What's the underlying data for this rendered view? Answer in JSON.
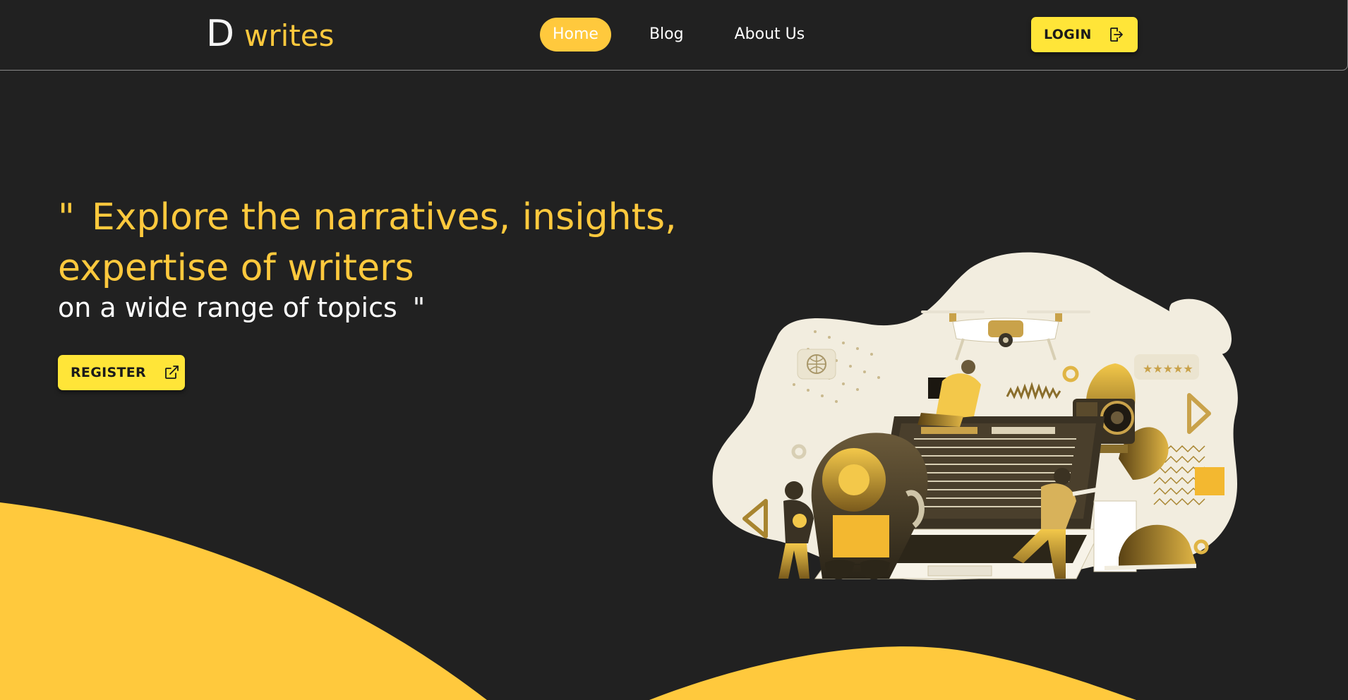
{
  "brand": {
    "letter": "D",
    "word": "writes",
    "accent_color": "#ffc93d",
    "button_color": "#ffe538",
    "background_color": "#212121"
  },
  "nav": {
    "items": [
      {
        "label": "Home",
        "active": true
      },
      {
        "label": "Blog",
        "active": false
      },
      {
        "label": "About Us",
        "active": false
      }
    ]
  },
  "header": {
    "login_label": "LOGIN",
    "login_icon": "logout-arrow-icon"
  },
  "hero": {
    "open_quote": "\"",
    "headline_line1": "Explore the narratives, insights,",
    "headline_line2": "expertise of writers",
    "subline": "on a wide range of topics",
    "close_quote": "\"",
    "register_label": "REGISTER",
    "register_icon": "external-link-icon"
  },
  "illustration": {
    "rating_stars": "★★★★★",
    "icon": "blogging-workspace-illustration"
  }
}
